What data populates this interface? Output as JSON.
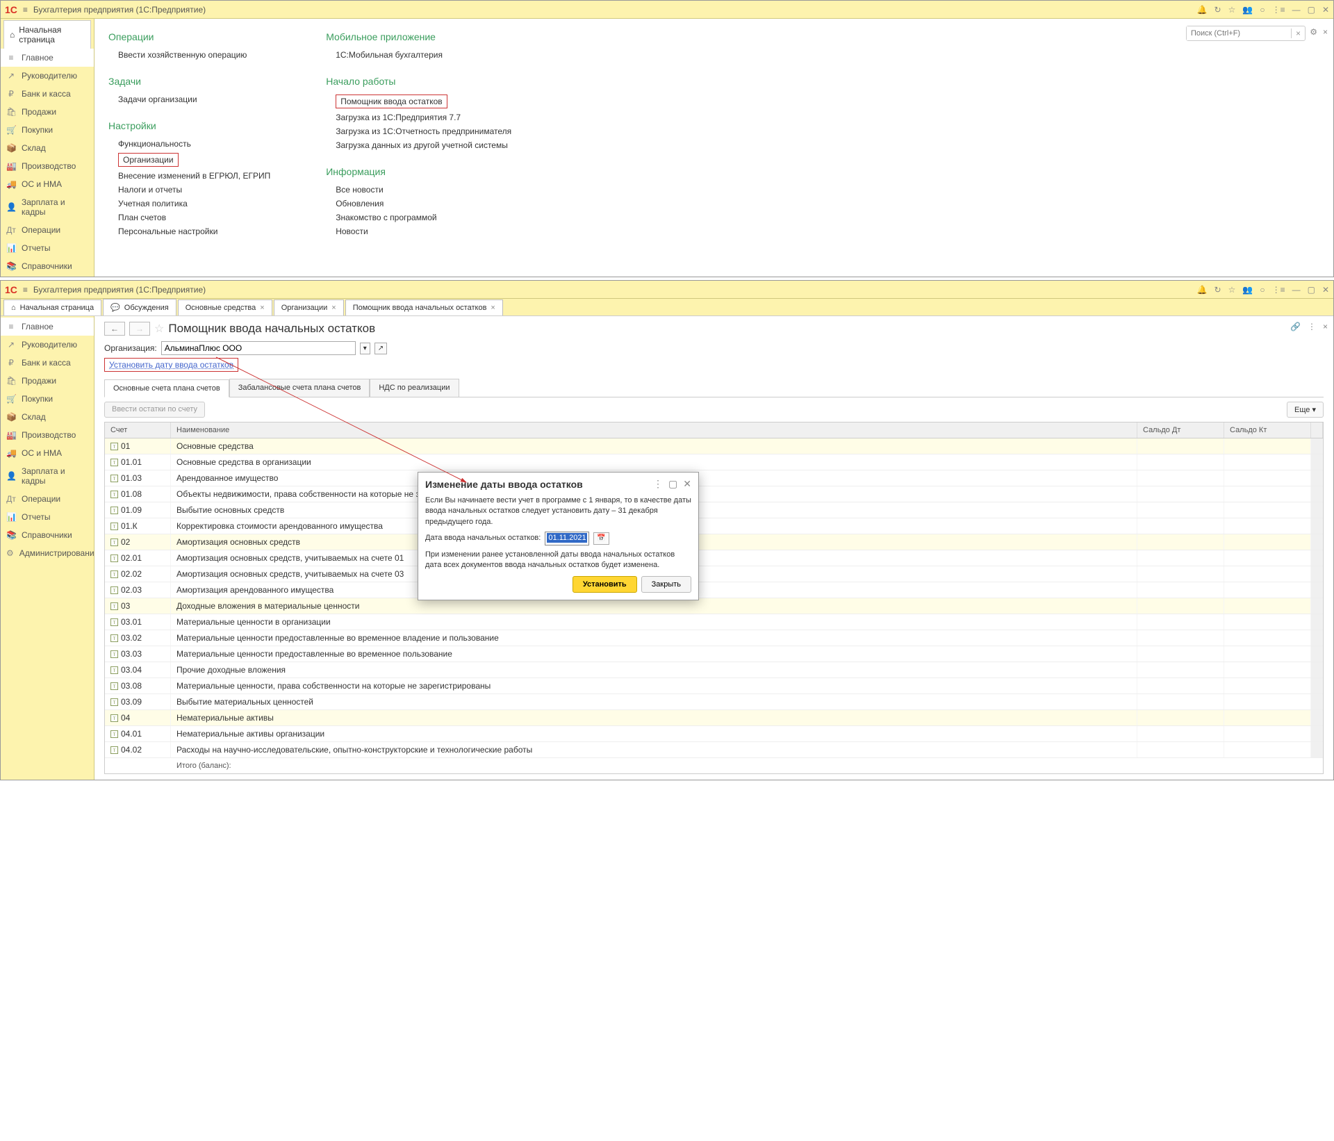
{
  "window1": {
    "title": "Бухгалтерия предприятия  (1С:Предприятие)",
    "start_tab": "Начальная страница",
    "search_placeholder": "Поиск (Ctrl+F)",
    "sidebar": [
      {
        "icon": "≡",
        "label": "Главное"
      },
      {
        "icon": "↗",
        "label": "Руководителю"
      },
      {
        "icon": "₽",
        "label": "Банк и касса"
      },
      {
        "icon": "🛍",
        "label": "Продажи"
      },
      {
        "icon": "🛒",
        "label": "Покупки"
      },
      {
        "icon": "📦",
        "label": "Склад"
      },
      {
        "icon": "🏭",
        "label": "Производство"
      },
      {
        "icon": "🚚",
        "label": "ОС и НМА"
      },
      {
        "icon": "👤",
        "label": "Зарплата и кадры"
      },
      {
        "icon": "Дт",
        "label": "Операции"
      },
      {
        "icon": "📊",
        "label": "Отчеты"
      },
      {
        "icon": "📚",
        "label": "Справочники"
      }
    ],
    "columns": {
      "left": [
        {
          "title": "Операции",
          "items": [
            "Ввести хозяйственную операцию"
          ]
        },
        {
          "title": "Задачи",
          "items": [
            "Задачи организации"
          ]
        },
        {
          "title": "Настройки",
          "items": [
            "Функциональность",
            "Организации",
            "Внесение изменений в ЕГРЮЛ, ЕГРИП",
            "Налоги и отчеты",
            "Учетная политика",
            "План счетов",
            "Персональные настройки"
          ]
        }
      ],
      "right": [
        {
          "title": "Мобильное приложение",
          "items": [
            "1С:Мобильная бухгалтерия"
          ]
        },
        {
          "title": "Начало работы",
          "items": [
            "Помощник ввода остатков",
            "Загрузка из 1С:Предприятия 7.7",
            "Загрузка из 1С:Отчетность предпринимателя",
            "Загрузка данных из другой учетной системы"
          ]
        },
        {
          "title": "Информация",
          "items": [
            "Все новости",
            "Обновления",
            "Знакомство с программой",
            "Новости"
          ]
        }
      ]
    }
  },
  "window2": {
    "title": "Бухгалтерия предприятия  (1С:Предприятие)",
    "tabs": [
      "Начальная страница",
      "Обсуждения",
      "Основные средства",
      "Организации",
      "Помощник ввода начальных остатков"
    ],
    "sidebar": [
      {
        "icon": "≡",
        "label": "Главное"
      },
      {
        "icon": "↗",
        "label": "Руководителю"
      },
      {
        "icon": "₽",
        "label": "Банк и касса"
      },
      {
        "icon": "🛍",
        "label": "Продажи"
      },
      {
        "icon": "🛒",
        "label": "Покупки"
      },
      {
        "icon": "📦",
        "label": "Склад"
      },
      {
        "icon": "🏭",
        "label": "Производство"
      },
      {
        "icon": "🚚",
        "label": "ОС и НМА"
      },
      {
        "icon": "👤",
        "label": "Зарплата и кадры"
      },
      {
        "icon": "Дт",
        "label": "Операции"
      },
      {
        "icon": "📊",
        "label": "Отчеты"
      },
      {
        "icon": "📚",
        "label": "Справочники"
      },
      {
        "icon": "⚙",
        "label": "Администрирование"
      }
    ],
    "heading": "Помощник ввода начальных остатков",
    "org_label": "Организация:",
    "org_value": "АльминаПлюс ООО",
    "set_date_link": "Установить дату ввода остатков",
    "subtabs": [
      "Основные счета плана счетов",
      "Забалансовые счета плана счетов",
      "НДС по реализации"
    ],
    "grid_button": "Ввести остатки по счету",
    "more_button": "Еще",
    "columns": {
      "acct": "Счет",
      "name": "Наименование",
      "dt": "Сальдо Дт",
      "kt": "Сальдо Кт"
    },
    "rows": [
      {
        "acct": "01",
        "name": "Основные средства",
        "hl": true
      },
      {
        "acct": "01.01",
        "name": "Основные средства в организации"
      },
      {
        "acct": "01.03",
        "name": "Арендованное имущество"
      },
      {
        "acct": "01.08",
        "name": "Объекты недвижимости, права собственности на которые не зарегистрированы"
      },
      {
        "acct": "01.09",
        "name": "Выбытие основных средств"
      },
      {
        "acct": "01.К",
        "name": "Корректировка стоимости арендованного имущества"
      },
      {
        "acct": "02",
        "name": "Амортизация основных средств",
        "hl": true
      },
      {
        "acct": "02.01",
        "name": "Амортизация основных средств, учитываемых на счете 01"
      },
      {
        "acct": "02.02",
        "name": "Амортизация основных средств, учитываемых на счете 03"
      },
      {
        "acct": "02.03",
        "name": "Амортизация арендованного имущества"
      },
      {
        "acct": "03",
        "name": "Доходные вложения в материальные ценности",
        "hl": true
      },
      {
        "acct": "03.01",
        "name": "Материальные ценности в организации"
      },
      {
        "acct": "03.02",
        "name": "Материальные ценности предоставленные во временное владение и пользование"
      },
      {
        "acct": "03.03",
        "name": "Материальные ценности предоставленные во временное пользование"
      },
      {
        "acct": "03.04",
        "name": "Прочие доходные вложения"
      },
      {
        "acct": "03.08",
        "name": "Материальные ценности, права собственности на которые не зарегистрированы"
      },
      {
        "acct": "03.09",
        "name": "Выбытие материальных ценностей"
      },
      {
        "acct": "04",
        "name": "Нематериальные активы",
        "hl": true
      },
      {
        "acct": "04.01",
        "name": "Нематериальные активы организации"
      },
      {
        "acct": "04.02",
        "name": "Расходы на научно-исследовательские, опытно-конструкторские и технологические работы"
      }
    ],
    "footer_label": "Итого (баланс):"
  },
  "dialog": {
    "title": "Изменение даты ввода остатков",
    "text1": "Если Вы начинаете вести учет в программе с 1 января, то в качестве даты ввода начальных остатков следует установить дату – 31 декабря предыдущего года.",
    "date_label": "Дата ввода начальных остатков:",
    "date_value": "01.11.2021",
    "text2": "При изменении ранее установленной даты ввода начальных остатков дата всех документов ввода начальных остатков будет изменена.",
    "btn_set": "Установить",
    "btn_close": "Закрыть"
  }
}
